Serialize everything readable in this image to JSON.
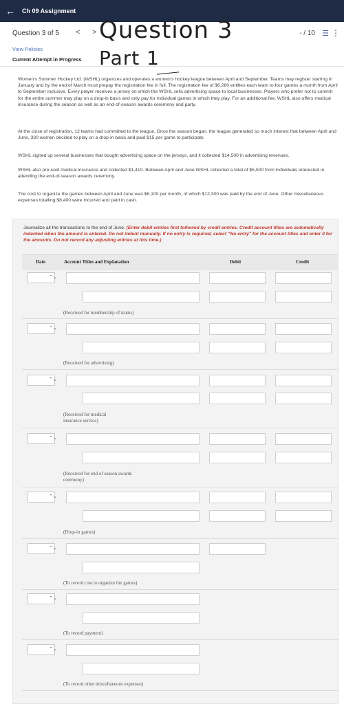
{
  "header": {
    "back_icon": "←",
    "title": "Ch 09 Assignment"
  },
  "question": {
    "label": "Question 3 of 5",
    "prev": "<",
    "next": ">",
    "score": "- / 10",
    "list_icon": "☰",
    "more_icon": "⋮"
  },
  "view_policies": "View Policies",
  "attempt": "Current Attempt in Progress",
  "handwriting": {
    "line1": "Question 3",
    "line2": "Part 1"
  },
  "paragraphs": [
    "Women's Summer Hockey Ltd. (WSHL) organizes and operates a women's hockey league between April and September. Teams may register starting in January and by the end of March must prepay the registration fee in full. The registration fee of $6,280 entitles each team to four games a month from April to September inclusive. Every player receives a jersey on which the WSHL sells advertising space to local businesses. Players who prefer not to commit for the entire summer may play on a drop-in basis and only pay for individual games in which they play. For an additional fee, WSHL also offers medical insurance during the season as well as an end-of-season awards ceremony and party.",
    "At the close of registration, 12 teams had committed to the league. Once the season began, the league generated so much interest that between April and June, 330 women decided to play on a drop-in basis and paid $15 per game to participate.",
    "WSHL signed up several businesses that bought advertising space on the jerseys, and it collected $14,500 in advertising revenues.",
    "WSHL also pre-sold medical insurance and collected $1,410. Between April and June WSHL collected a total of $5,500 from individuals interested in attending the end-of-season awards ceremony.",
    "The cost to organize the games between April and June was $6,100 per month, of which $12,300 was paid by the end of June. Other miscellaneous expenses totalling $8,400 were incurred and paid in cash."
  ],
  "instructions": {
    "plain": "Journalize all the transactions to the end of June. ",
    "emphasis": "(Enter debit entries first followed by credit entries. Credit account titles are automatically indented when the amount is entered. Do not indent manually. If no entry is required, select \"No entry\" for the account titles and enter 0 for the amounts. Do not record any adjusting entries at this time.)"
  },
  "table": {
    "headers": {
      "date": "Date",
      "account": "Account Titles and Explanation",
      "debit": "Debit",
      "credit": "Credit"
    },
    "chevron": "⌃⌄",
    "entries": [
      {
        "explanation": "(Received for membership of teams)"
      },
      {
        "explanation": "(Received for advertising)"
      },
      {
        "explanation": "(Received for medical insurance service)"
      },
      {
        "explanation": "(Received for end of season awards ceremony)"
      },
      {
        "explanation": "(Drop-in games)"
      },
      {
        "explanation": "(To record cost to organize the games)"
      },
      {
        "explanation": "(To record payment)"
      },
      {
        "explanation": "(To record other miscellaneous expenses)"
      }
    ]
  }
}
